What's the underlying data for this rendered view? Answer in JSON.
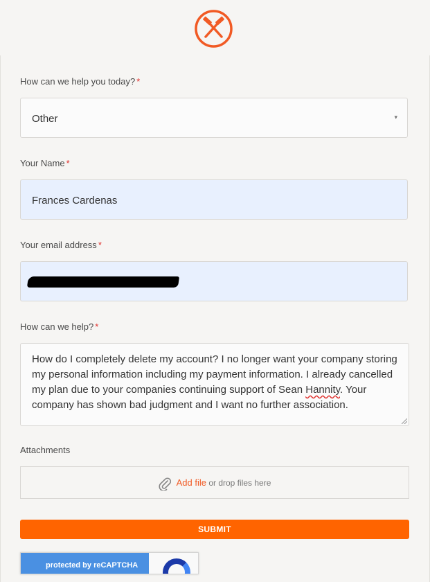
{
  "header": {
    "logo_icon": "crossed-hammers-logo",
    "brand_color": "#f15a24"
  },
  "form": {
    "help_topic": {
      "label": "How can we help you today?",
      "required_mark": "*",
      "value": "Other",
      "caret": "▾"
    },
    "name": {
      "label": "Your Name",
      "required_mark": "*",
      "value": "Frances Cardenas"
    },
    "email": {
      "label": "Your email address",
      "required_mark": "*"
    },
    "message": {
      "label": "How can we help?",
      "required_mark": "*",
      "value_before": "How do I completely delete my account? I no longer want your company storing my personal information including my payment information. I already cancelled my plan due to your companies continuing support of Sean ",
      "value_flagged": "Hannity",
      "value_after": ". Your company has shown bad judgment and I want no further association."
    },
    "attachments": {
      "label": "Attachments",
      "add_file": "Add file",
      "drop_text": "or drop files here"
    },
    "submit_label": "SUBMIT",
    "captcha_text": "protected by reCAPTCHA"
  },
  "colors": {
    "accent": "#ff6400",
    "required": "#e0302d",
    "autofill_bg": "#e8f0fe"
  }
}
